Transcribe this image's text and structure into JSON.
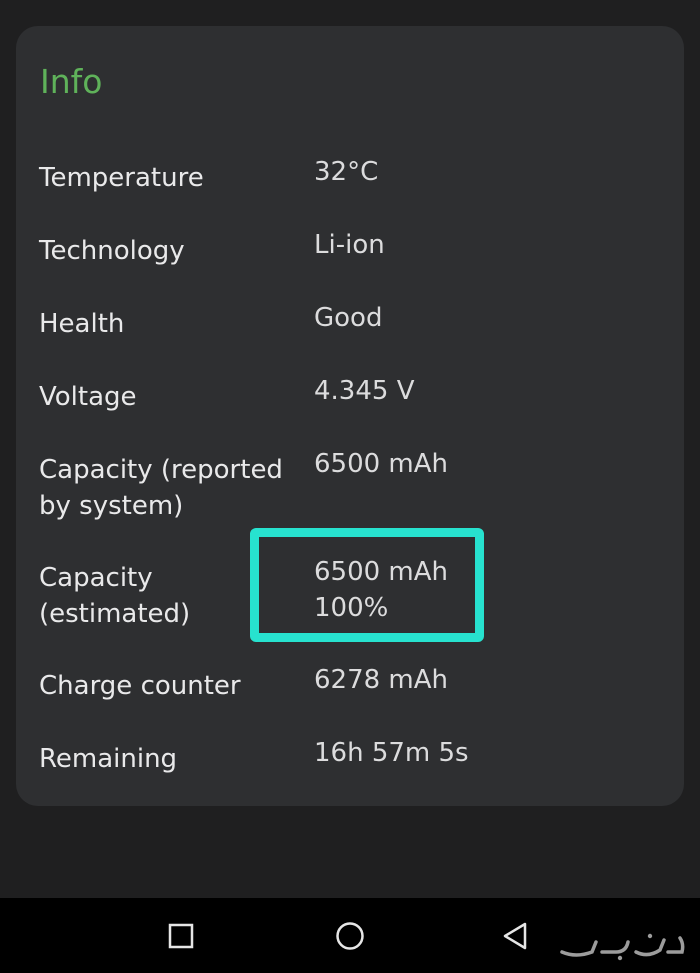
{
  "card": {
    "title": "Info",
    "rows": [
      {
        "label": "Temperature",
        "value": "32°C"
      },
      {
        "label": "Technology",
        "value": "Li-ion"
      },
      {
        "label": "Health",
        "value": "Good"
      },
      {
        "label": "Voltage",
        "value": "4.345 V"
      },
      {
        "label": "Capacity (reported by system)",
        "value": "6500 mAh"
      },
      {
        "label": "Capacity (estimated)",
        "value": "6500 mAh\n100%"
      },
      {
        "label": "Charge counter",
        "value": "6278 mAh"
      },
      {
        "label": "Remaining",
        "value": "16h 57m 5s"
      }
    ]
  },
  "colors": {
    "accent": "#5fb25a",
    "highlight": "#27e2cf",
    "card_bg": "#2e2f31",
    "page_bg": "#1f1f20",
    "navbar_bg": "#000000"
  },
  "navbar": {
    "icons": [
      "recents-square-icon",
      "home-circle-icon",
      "back-triangle-icon"
    ]
  },
  "watermark": {
    "text": "حراج"
  }
}
